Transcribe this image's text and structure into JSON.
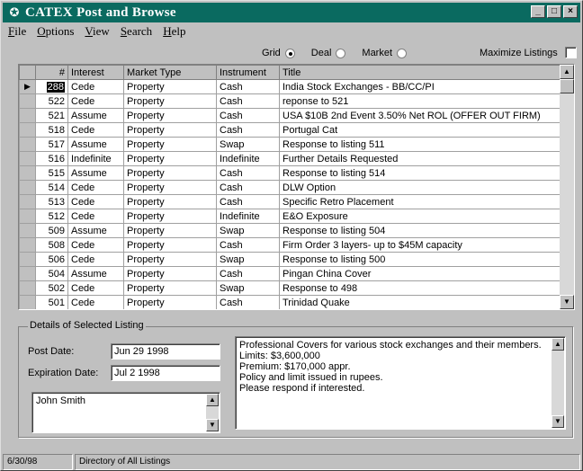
{
  "window": {
    "title": "CATEX Post and Browse",
    "app_icon": "catex-logo-icon",
    "controls": {
      "minimize": "_",
      "maximize": "□",
      "close": "×"
    }
  },
  "menu": [
    "File",
    "Options",
    "View",
    "Search",
    "Help"
  ],
  "view_mode": {
    "options": [
      {
        "label": "Grid",
        "checked": true
      },
      {
        "label": "Deal",
        "checked": false
      },
      {
        "label": "Market",
        "checked": false
      }
    ],
    "maximize_label": "Maximize Listings",
    "maximize_checked": false
  },
  "grid": {
    "columns": [
      "#",
      "Interest",
      "Market Type",
      "Instrument",
      "Title"
    ],
    "rows": [
      {
        "num": "288",
        "interest": "Cede",
        "market_type": "Property",
        "instrument": "Cash",
        "title": "India Stock Exchanges - BB/CC/PI",
        "selected": true
      },
      {
        "num": "522",
        "interest": "Cede",
        "market_type": "Property",
        "instrument": "Cash",
        "title": "reponse to 521"
      },
      {
        "num": "521",
        "interest": "Assume",
        "market_type": "Property",
        "instrument": "Cash",
        "title": "USA $10B 2nd Event 3.50% Net ROL  (OFFER OUT FIRM)"
      },
      {
        "num": "518",
        "interest": "Cede",
        "market_type": "Property",
        "instrument": "Cash",
        "title": "Portugal Cat"
      },
      {
        "num": "517",
        "interest": "Assume",
        "market_type": "Property",
        "instrument": "Swap",
        "title": "Response to listing  511"
      },
      {
        "num": "516",
        "interest": "Indefinite",
        "market_type": "Property",
        "instrument": "Indefinite",
        "title": "Further Details Requested"
      },
      {
        "num": "515",
        "interest": "Assume",
        "market_type": "Property",
        "instrument": "Cash",
        "title": "Response to listing  514"
      },
      {
        "num": "514",
        "interest": "Cede",
        "market_type": "Property",
        "instrument": "Cash",
        "title": "DLW Option"
      },
      {
        "num": "513",
        "interest": "Cede",
        "market_type": "Property",
        "instrument": "Cash",
        "title": "Specific Retro Placement"
      },
      {
        "num": "512",
        "interest": "Cede",
        "market_type": "Property",
        "instrument": "Indefinite",
        "title": "E&O Exposure"
      },
      {
        "num": "509",
        "interest": "Assume",
        "market_type": "Property",
        "instrument": "Swap",
        "title": "Response to listing  504"
      },
      {
        "num": "508",
        "interest": "Cede",
        "market_type": "Property",
        "instrument": "Cash",
        "title": "Firm Order      3 layers- up to $45M capacity"
      },
      {
        "num": "506",
        "interest": "Cede",
        "market_type": "Property",
        "instrument": "Swap",
        "title": "Response to listing  500"
      },
      {
        "num": "504",
        "interest": "Assume",
        "market_type": "Property",
        "instrument": "Cash",
        "title": "Pingan China Cover"
      },
      {
        "num": "502",
        "interest": "Cede",
        "market_type": "Property",
        "instrument": "Swap",
        "title": "Response to 498"
      },
      {
        "num": "501",
        "interest": "Cede",
        "market_type": "Property",
        "instrument": "Cash",
        "title": "Trinidad Quake"
      }
    ]
  },
  "details": {
    "group_label": "Details of Selected Listing",
    "post_date_label": "Post Date:",
    "post_date": "Jun 29 1998",
    "expiration_date_label": "Expiration Date:",
    "expiration_date": "Jul  2 1998",
    "contact": "John Smith",
    "description_lines": [
      "Professional Covers for various stock exchanges and their members.",
      "Limits: $3,600,000",
      "Premium: $170,000 appr.",
      "Policy and limit issued in rupees.",
      "Please respond if interested."
    ]
  },
  "status": {
    "date": "6/30/98",
    "message": "Directory of All Listings"
  }
}
